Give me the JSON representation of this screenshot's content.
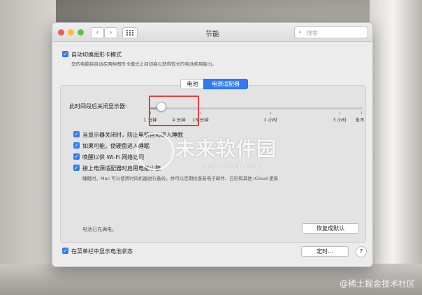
{
  "window": {
    "title": "节能",
    "search_placeholder": "搜索",
    "nav_back": "‹",
    "nav_forward": "›"
  },
  "auto_switch": {
    "label": "自动切换图形卡模式",
    "description": "您的电脑将自动在两种图形卡模式之间切换以获得较长的电池使用能力。",
    "checked": true
  },
  "tabs": [
    "电池",
    "电源适配器"
  ],
  "active_tab": "电源适配器",
  "display_sleep": {
    "label": "此时间段后关闭显示器:",
    "value_label": "4 分钟",
    "value_minutes": 4,
    "ticks": [
      "1 分钟",
      "15 分钟",
      "1 小时",
      "3 小时",
      "永不"
    ]
  },
  "options": [
    {
      "label": "当显示器关闭时，防止电脑自动进入睡眠",
      "checked": true
    },
    {
      "label": "如果可能，使硬盘进入睡眠",
      "checked": true
    },
    {
      "label": "唤醒以供 Wi-Fi 网络访问",
      "checked": true
    },
    {
      "label": "接上电源适配器时启用电能小憩",
      "checked": true
    }
  ],
  "power_nap_description": "睡眠时，Mac 可以使用时间机器进行备份，并可以定期检查新电子邮件、日历和其他 iCloud 更新",
  "battery_status": "电池已充满电。",
  "restore_defaults_button": "恢复成默认",
  "menu_bar_checkbox": {
    "label": "在菜单栏中显示电池状态",
    "checked": true
  },
  "schedule_button": "定时...",
  "help_button": "?",
  "watermark": {
    "main": "未来软件园",
    "url": "mac.orsoon.com"
  },
  "credit": "@稀土掘金技术社区",
  "colors": {
    "accent": "#2f7cf6",
    "highlight_box": "#e3403a"
  }
}
